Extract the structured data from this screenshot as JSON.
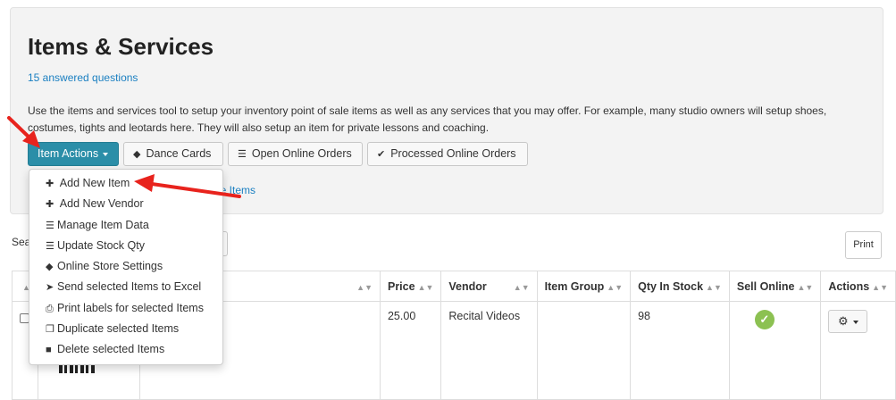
{
  "header": {
    "title": "Items & Services",
    "answered_link": "15 answered questions",
    "description": "Use the items and services tool to setup your inventory point of sale items as well as any services that you may offer. For example, many studio owners will setup shoes, costumes, tights and leotards here. They will also setup an item for private lessons and coaching."
  },
  "toolbar": {
    "item_actions": "Item Actions",
    "dance_cards": "Dance Cards",
    "open_online_orders": "Open Online Orders",
    "processed_online_orders": "Processed Online Orders"
  },
  "partial_link": "ne Items",
  "search_label": "Sea",
  "print_label": "Print",
  "dropdown": {
    "items": [
      {
        "label": "Add New Item",
        "icon": "plus-icon"
      },
      {
        "label": "Add New Vendor",
        "icon": "plus-icon"
      },
      {
        "label": "Manage Item Data",
        "icon": "list-icon"
      },
      {
        "label": "Update Stock Qty",
        "icon": "list-icon"
      },
      {
        "label": "Online Store Settings",
        "icon": "tag-icon"
      },
      {
        "label": "Send selected Items to Excel",
        "icon": "send-icon"
      },
      {
        "label": "Print labels for selected Items",
        "icon": "print-icon"
      },
      {
        "label": "Duplicate selected Items",
        "icon": "copy-icon"
      },
      {
        "label": "Delete selected Items",
        "icon": "trash-icon"
      }
    ]
  },
  "table": {
    "headers": {
      "price": "Price",
      "vendor": "Vendor",
      "item_group": "Item Group",
      "qty_in_stock": "Qty In Stock",
      "sell_online": "Sell Online",
      "actions": "Actions"
    },
    "row": {
      "price": "25.00",
      "vendor": "Recital Videos",
      "item_group": "",
      "qty_in_stock": "98",
      "sell_online": true
    }
  },
  "colors": {
    "primary": "#2b8ea8",
    "link": "#1a7fc1",
    "annotation_arrow": "#e8231d",
    "success": "#8cc152"
  }
}
